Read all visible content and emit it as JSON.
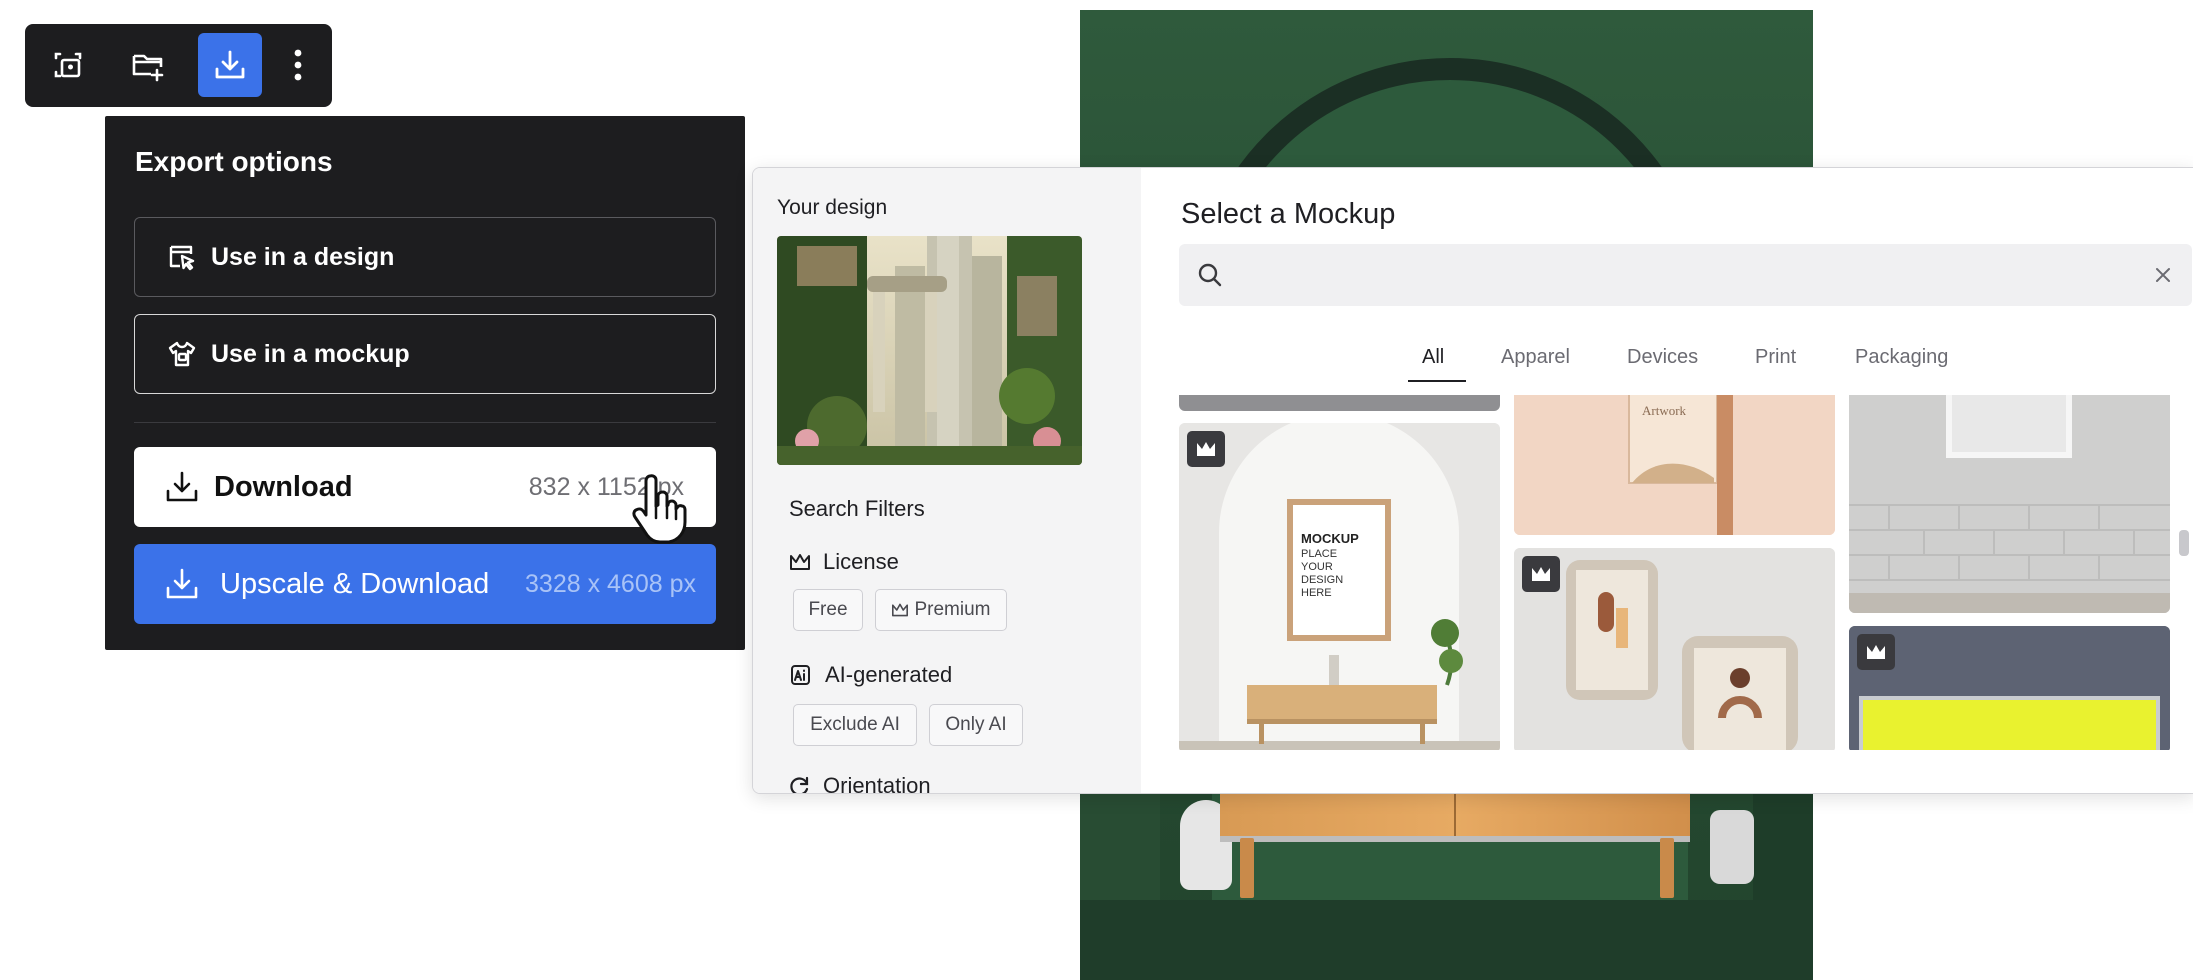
{
  "toolbar": {
    "buttons": [
      {
        "icon": "frame-image-icon"
      },
      {
        "icon": "folder-add-icon"
      },
      {
        "icon": "download-icon",
        "active": true
      },
      {
        "icon": "more-vertical-icon"
      }
    ]
  },
  "export": {
    "title": "Export options",
    "use_in_design": "Use in a design",
    "use_in_mockup": "Use in a mockup",
    "download_label": "Download",
    "download_size": "832 x 1152 px",
    "upscale_label": "Upscale & Download",
    "upscale_size": "3328 x 4608 px"
  },
  "modal": {
    "sidebar": {
      "your_design": "Your design",
      "search_filters": "Search Filters",
      "license": {
        "title": "License",
        "options": [
          "Free",
          "Premium"
        ]
      },
      "ai_generated": {
        "title": "AI-generated",
        "options": [
          "Exclude AI",
          "Only AI"
        ]
      },
      "orientation": {
        "title": "Orientation"
      }
    },
    "title": "Select a Mockup",
    "search": {
      "placeholder": "",
      "value": ""
    },
    "tabs": [
      "All",
      "Apparel",
      "Devices",
      "Print",
      "Packaging"
    ],
    "active_tab": "All",
    "mockups": [
      {
        "frame_text": "MOCKUP\nPLACE\nYOUR\nDESIGN\nHERE",
        "premium": true
      },
      {
        "frame_text": "Artwork",
        "premium": false
      },
      {
        "premium": false
      },
      {
        "premium": true
      },
      {
        "premium": true
      }
    ]
  },
  "colors": {
    "accent": "#3b72e9",
    "panel_dark": "#1d1d1f",
    "scene_green": "#2f5a3c"
  }
}
